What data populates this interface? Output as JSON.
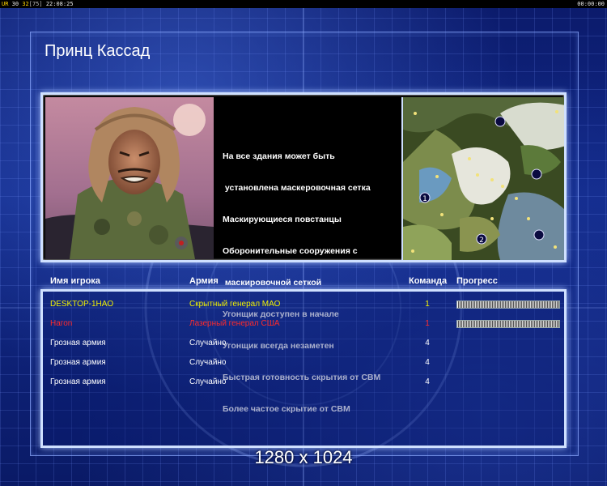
{
  "status_bar": {
    "left_prefix": "UR",
    "fps": "30",
    "value2": "32",
    "value3": "[75]",
    "clock": "22:08:25",
    "right_timer": "00:00:00"
  },
  "title": "Принц Кассад",
  "features": [
    "На все здания может быть",
    " установлена маскеровочная сетка",
    "Маскирующиеся повстанцы",
    "Оборонительные сооружения с",
    " маскировочной сеткой",
    "Угонщик доступен в начале",
    "Угонщик всегда незаметен",
    "Быстрая готовность скрытия от СВМ",
    "Более частое скрытие от СВМ"
  ],
  "minimap": {
    "start_labels": [
      "1",
      "2"
    ]
  },
  "table": {
    "headers": {
      "player": "Имя игрока",
      "army": "Армия",
      "team": "Команда",
      "progress": "Прогресс"
    },
    "rows": [
      {
        "name": "DESKTOP-1HAO",
        "army": "Скрытный генерал МАО",
        "team": "1",
        "progress": 0.01,
        "color": "#f2f200"
      },
      {
        "name": "Hагоn",
        "army": "Лазерный генерал США",
        "team": "1",
        "progress": 0.0,
        "color": "#ff2a2a"
      },
      {
        "name": "Грозная армия",
        "army": "Случайно",
        "team": "4",
        "progress": null,
        "color": "#ffffff"
      },
      {
        "name": "Грозная армия",
        "army": "Случайно",
        "team": "4",
        "progress": null,
        "color": "#ffffff"
      },
      {
        "name": "Грозная армия",
        "army": "Случайно",
        "team": "4",
        "progress": null,
        "color": "#ffffff"
      }
    ]
  },
  "resolution_label": "1280 x 1024",
  "colors": {
    "accent_frame": "#cfe0ff",
    "background": "#122a8a"
  }
}
